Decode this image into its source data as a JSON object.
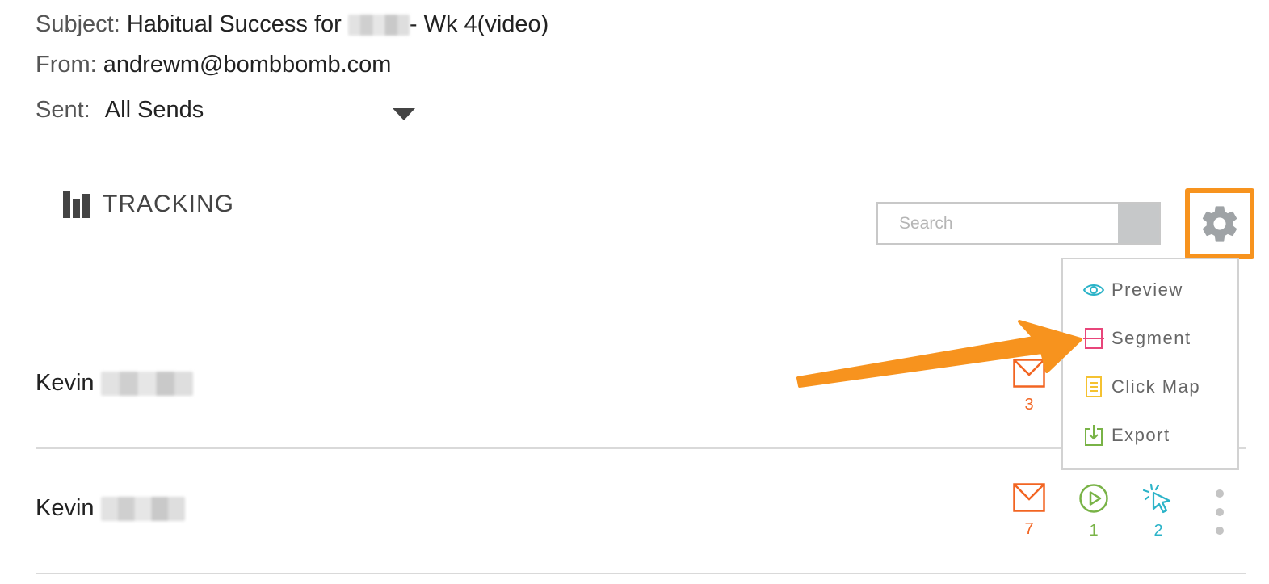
{
  "email": {
    "subject_label": "Subject:",
    "subject_value": "Habitual Success for",
    "subject_suffix": "- Wk 4(video)",
    "from_label": "From:",
    "from_value": "andrewm@bombbomb.com",
    "sent_label": "Sent:",
    "sent_value": "All Sends"
  },
  "tracking": {
    "title": "TRACKING",
    "search_placeholder": "Search"
  },
  "menu": {
    "items": [
      {
        "label": "Preview",
        "icon": "eye-icon",
        "color": "#2bb3c8"
      },
      {
        "label": "Segment",
        "icon": "segment-icon",
        "color": "#e8457a"
      },
      {
        "label": "Click Map",
        "icon": "clickmap-icon",
        "color": "#f5c231"
      },
      {
        "label": "Export",
        "icon": "export-icon",
        "color": "#79b347"
      }
    ]
  },
  "recipients": [
    {
      "first_name": "Kevin",
      "email_opens": "3"
    },
    {
      "first_name": "Kevin",
      "email_opens": "7",
      "video_plays": "1",
      "clicks": "2"
    }
  ],
  "colors": {
    "highlight": "#f7931e",
    "email": "#f26522",
    "video": "#79b347",
    "click": "#2bb3c8"
  }
}
